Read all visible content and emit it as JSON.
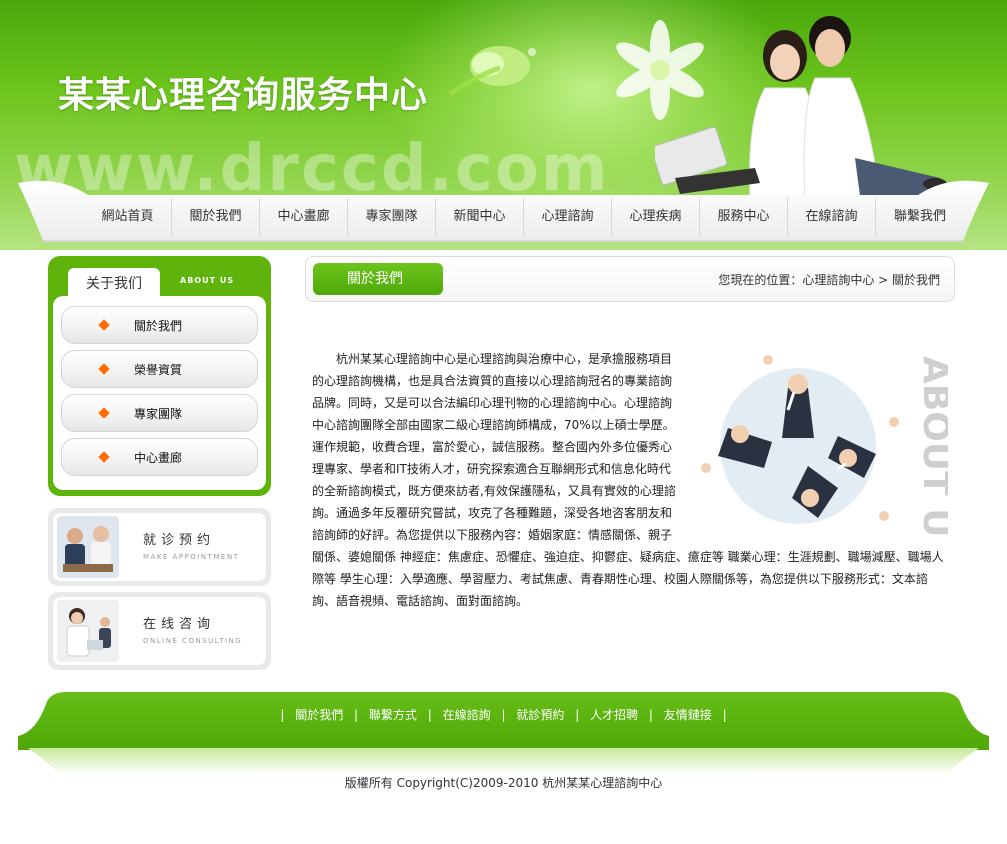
{
  "header": {
    "site_title": "某某心理咨询服务中心",
    "watermark": "www.drccd.com"
  },
  "nav": {
    "items": [
      {
        "label": "網站首頁"
      },
      {
        "label": "關於我們"
      },
      {
        "label": "中心畫廊"
      },
      {
        "label": "專家團隊"
      },
      {
        "label": "新聞中心"
      },
      {
        "label": "心理諮詢"
      },
      {
        "label": "心理疾病"
      },
      {
        "label": "服務中心"
      },
      {
        "label": "在線諮詢"
      },
      {
        "label": "聯繫我們"
      }
    ]
  },
  "sidebar": {
    "tab_label": "关于我们",
    "tab_label_en": "ABOUT US",
    "links": [
      {
        "label": "關於我們"
      },
      {
        "label": "榮譽資質"
      },
      {
        "label": "專家團隊"
      },
      {
        "label": "中心畫廊"
      }
    ],
    "promos": [
      {
        "title": "就诊预约",
        "subtitle": "MAKE APPOINTMENT"
      },
      {
        "title": "在线咨询",
        "subtitle": "ONLINE CONSULTING"
      }
    ]
  },
  "content": {
    "section_title": "關於我們",
    "breadcrumb": "您現在的位置：心理諮詢中心 > 關於我們",
    "side_watermark": "ABOUT US",
    "body": "杭州某某心理諮詢中心是心理諮詢與治療中心，是承擔服務項目的心理諮詢機構，也是具合法資質的直接以心理諮詢冠名的專業諮詢品牌。同時，又是可以合法編印心理刊物的心理諮詢中心。心理諮詢中心諮詢團隊全部由國家二級心理諮詢師構成，70%以上碩士學歷。運作規範，收費合理，富於愛心，誠信服務。整合國內外多位優秀心理專家、學者和IT技術人才，研究探索適合互聯網形式和信息化時代的全新諮詢模式，既方便來訪者,有效保護隱私，又具有實效的心理諮詢。通過多年反覆研究嘗試，攻克了各種難題，深受各地咨客朋友和諮詢師的好評。為您提供以下服務內容：婚姻家庭：情感關係、親子關係、婆媳關係 神經症：焦慮症、恐懼症、強迫症、抑鬱症、疑病症、癔症等 職業心理：生涯規劃、職場減壓、職場人際等 學生心理：入學適應、學習壓力、考試焦慮、青春期性心理、校園人際關係等，為您提供以下服務形式：文本諮詢、語音視頻、電話諮詢、面對面諮詢。"
  },
  "footer": {
    "links": [
      {
        "label": "關於我們"
      },
      {
        "label": "聯繫方式"
      },
      {
        "label": "在線諮詢"
      },
      {
        "label": "就診預約"
      },
      {
        "label": "人才招聘"
      },
      {
        "label": "友情鏈接"
      }
    ],
    "copyright": "版權所有 Copyright(C)2009-2010 杭州某某心理諮詢中心"
  },
  "colors": {
    "brand_green": "#5eb40a",
    "accent_orange": "#ff6a00"
  }
}
